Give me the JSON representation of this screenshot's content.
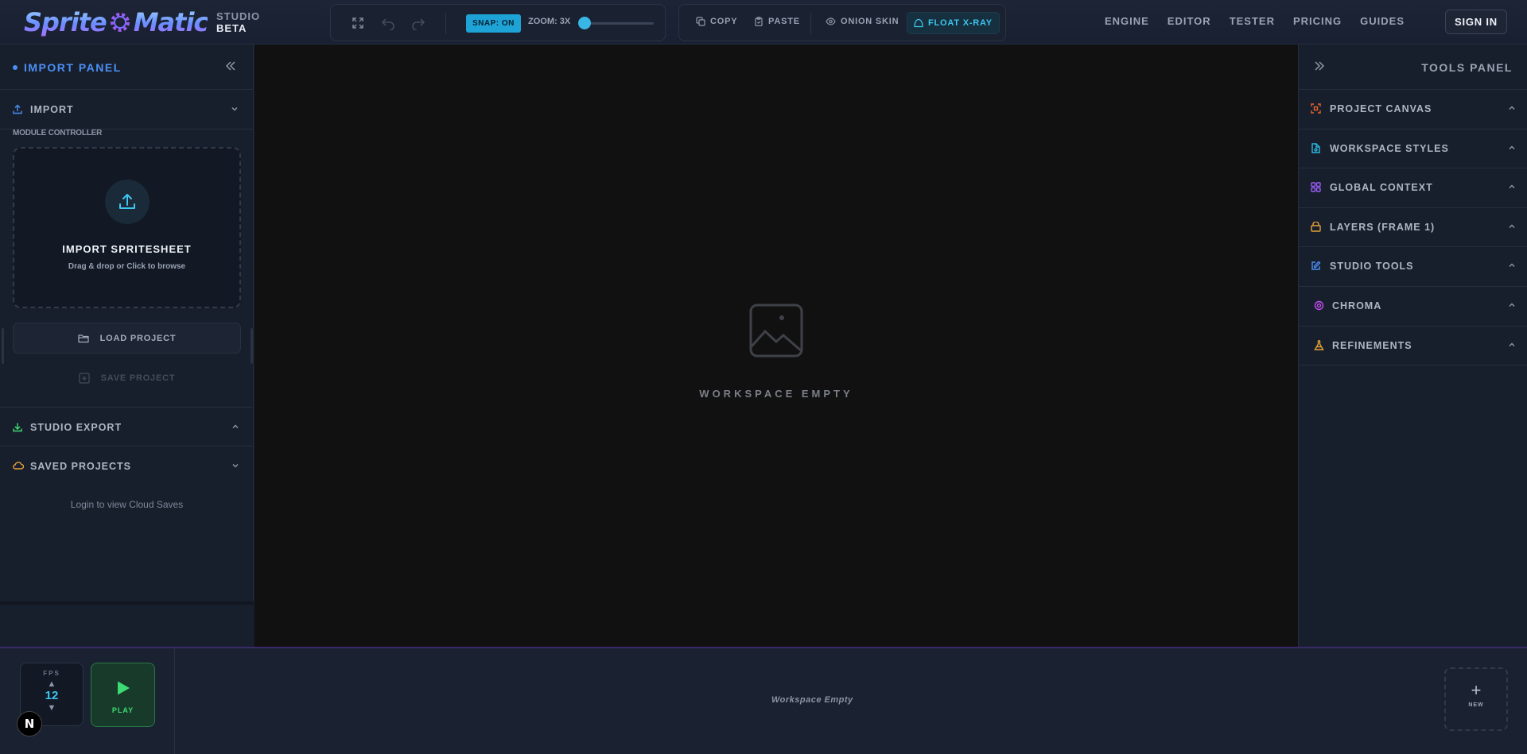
{
  "app": {
    "logo_text_left": "Sprite",
    "logo_text_right": "Matic",
    "studio_label": "STUDIO",
    "beta_label": "BETA"
  },
  "toolbar": {
    "snap_label": "SNAP: ON",
    "zoom_label": "ZOOM: 3X",
    "zoom_level_fraction": 0.0,
    "copy_label": "COPY",
    "paste_label": "PASTE",
    "onion_skin_label": "ONION SKIN",
    "float_xray_label": "FLOAT X-RAY"
  },
  "nav": {
    "items": [
      "ENGINE",
      "EDITOR",
      "TESTER",
      "PRICING",
      "GUIDES"
    ],
    "sign_in_label": "SIGN IN"
  },
  "left_panel": {
    "title": "IMPORT PANEL",
    "import_section": "IMPORT",
    "module_label": "MODULE CONTROLLER",
    "dropzone_title": "IMPORT SPRITESHEET",
    "dropzone_subtitle": "Drag & drop or Click to browse",
    "load_project_label": "LOAD PROJECT",
    "save_project_label": "SAVE PROJECT",
    "studio_export_label": "STUDIO EXPORT",
    "saved_projects_label": "SAVED PROJECTS",
    "cloud_note": "Login to view Cloud Saves"
  },
  "canvas": {
    "empty_label": "WORKSPACE EMPTY"
  },
  "right_panel": {
    "title": "TOOLS PANEL",
    "sections": [
      {
        "label": "PROJECT CANVAS",
        "icon": "canvas-icon",
        "color": "#e8622c"
      },
      {
        "label": "WORKSPACE STYLES",
        "icon": "styles-icon",
        "color": "#2bb8e0"
      },
      {
        "label": "GLOBAL CONTEXT",
        "icon": "grid-icon",
        "color": "#9b5cf5"
      },
      {
        "label": "LAYERS (FRAME 1)",
        "icon": "layers-icon",
        "color": "#e7a23a"
      },
      {
        "label": "STUDIO TOOLS",
        "icon": "edit-icon",
        "color": "#4b8ff5"
      },
      {
        "label": "CHROMA",
        "icon": "chroma-icon",
        "color": "#c34ff0"
      },
      {
        "label": "REFINEMENTS",
        "icon": "flask-icon",
        "color": "#e7a23a"
      }
    ]
  },
  "timeline": {
    "fps_label": "FPS",
    "fps_value": "12",
    "play_label": "PLAY",
    "empty_label": "Workspace Empty",
    "new_label": "NEW",
    "badge_letter": "N"
  },
  "colors": {
    "accent_blue": "#4b8ff5",
    "accent_cyan": "#3ec5f0",
    "play_green": "#3ddc73"
  }
}
